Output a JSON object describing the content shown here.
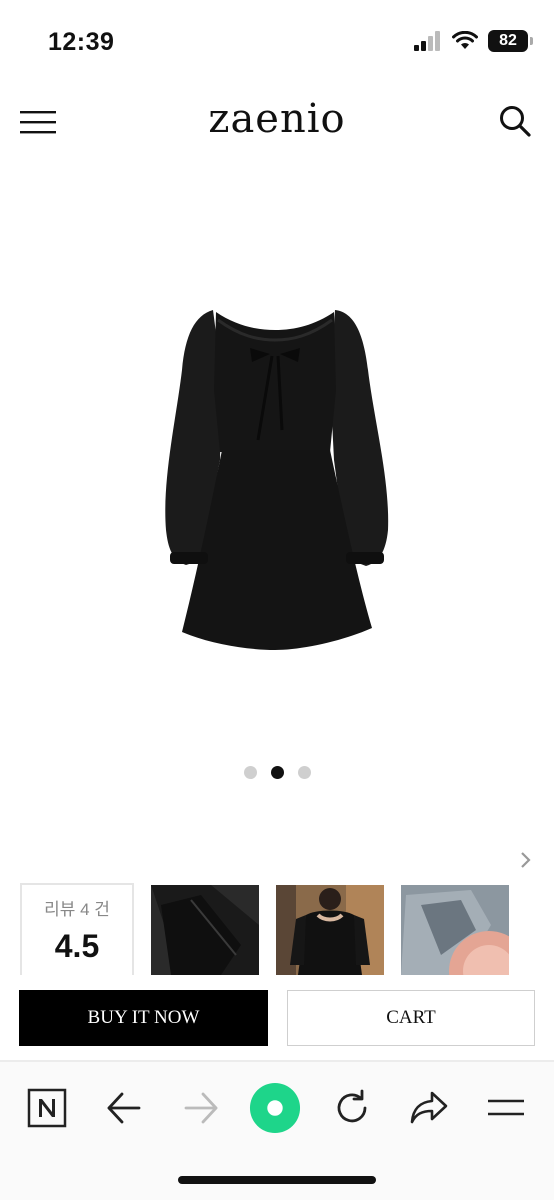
{
  "status_bar": {
    "time": "12:39",
    "battery_level": "82",
    "signal_icon": "cellular-signal-icon",
    "wifi_icon": "wifi-icon"
  },
  "header": {
    "menu_icon": "hamburger-menu-icon",
    "logo": "zaenio",
    "search_icon": "search-icon"
  },
  "product": {
    "image_alt": "black-dress-product-image",
    "carousel": {
      "total": 3,
      "active_index": 1
    }
  },
  "reviews": {
    "count_label": "리뷰 4 건",
    "score": "4.5",
    "next_icon": "chevron-right-icon",
    "thumbnails": [
      "review-photo-1",
      "review-photo-2",
      "review-photo-3"
    ]
  },
  "actions": {
    "buy_now_label": "BUY IT NOW",
    "cart_label": "CART"
  },
  "browser_toolbar": {
    "items": [
      "naver-home-icon",
      "back-arrow-icon",
      "forward-arrow-icon",
      "green-dot-icon",
      "refresh-icon",
      "share-icon",
      "menu-icon"
    ]
  },
  "colors": {
    "accent_green": "#1ED58A",
    "button_black": "#000000",
    "dot_inactive": "#CFCFCF"
  }
}
